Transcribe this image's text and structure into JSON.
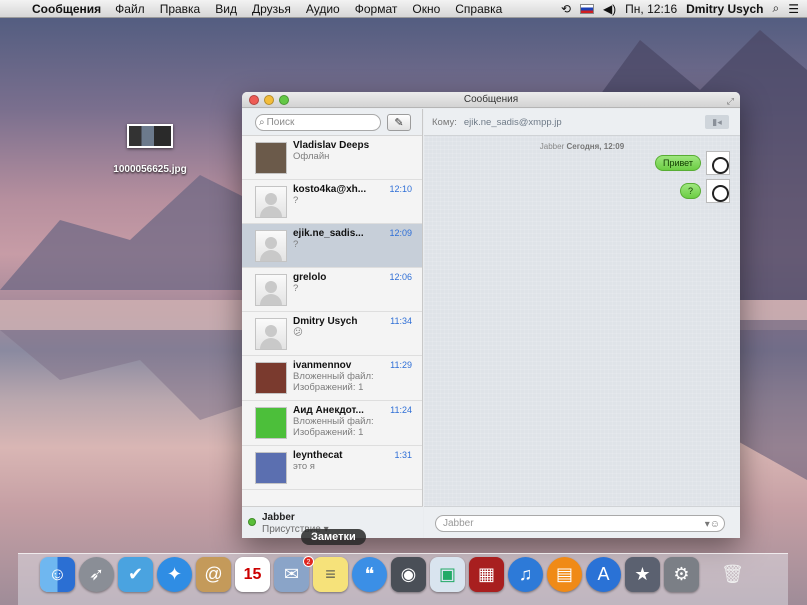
{
  "menubar": {
    "app_name": "Сообщения",
    "items": [
      "Файл",
      "Правка",
      "Вид",
      "Друзья",
      "Аудио",
      "Формат",
      "Окно",
      "Справка"
    ],
    "clock": "Пн, 12:16",
    "user": "Dmitry Usych"
  },
  "desktop": {
    "file_name": "1000056625.jpg"
  },
  "window": {
    "title": "Сообщения",
    "search_placeholder": "Поиск",
    "to_label": "Кому:",
    "to_value": "ejik.ne_sadis@xmpp.jp",
    "chat_meta_service": "Jabber",
    "chat_meta_time": "Сегодня, 12:09",
    "input_placeholder": "Jabber",
    "account_name": "Jabber",
    "account_status": "Присутствие ▾"
  },
  "conversations": [
    {
      "name": "Vladislav Deeps",
      "time": "",
      "preview": "Офлайн"
    },
    {
      "name": "kosto4ka@xh...",
      "time": "12:10",
      "preview": "?"
    },
    {
      "name": "ejik.ne_sadis...",
      "time": "12:09",
      "preview": "?"
    },
    {
      "name": "grelolo",
      "time": "12:06",
      "preview": "?"
    },
    {
      "name": "Dmitry Usych",
      "time": "11:34",
      "preview": "😕"
    },
    {
      "name": "ivanmennov",
      "time": "11:29",
      "preview": "Вложенный файл: Изображений: 1"
    },
    {
      "name": "Аид Анекдот...",
      "time": "11:24",
      "preview": "Вложенный файл: Изображений: 1"
    },
    {
      "name": "leynthecat",
      "time": "1:31",
      "preview": "это я"
    }
  ],
  "messages": [
    {
      "text": "Привет"
    },
    {
      "text": "?"
    }
  ],
  "dock": {
    "tooltip": "Заметки",
    "badge": "2",
    "icons": [
      "finder-icon",
      "launchpad-icon",
      "vk-classic-icon",
      "safari-icon",
      "contacts-icon",
      "calendar-icon",
      "mail-icon",
      "notes-icon",
      "messages-icon",
      "facetime-icon",
      "preview-icon",
      "photo-booth-icon",
      "itunes-icon",
      "ibooks-icon",
      "app-store-icon",
      "imovie-icon",
      "system-preferences-icon",
      "trash-icon"
    ],
    "calendar_day": "15"
  },
  "colors": {
    "accent": "#2f6fd6",
    "bubble": "#6ccd44",
    "selection": "#c7cfd9"
  }
}
